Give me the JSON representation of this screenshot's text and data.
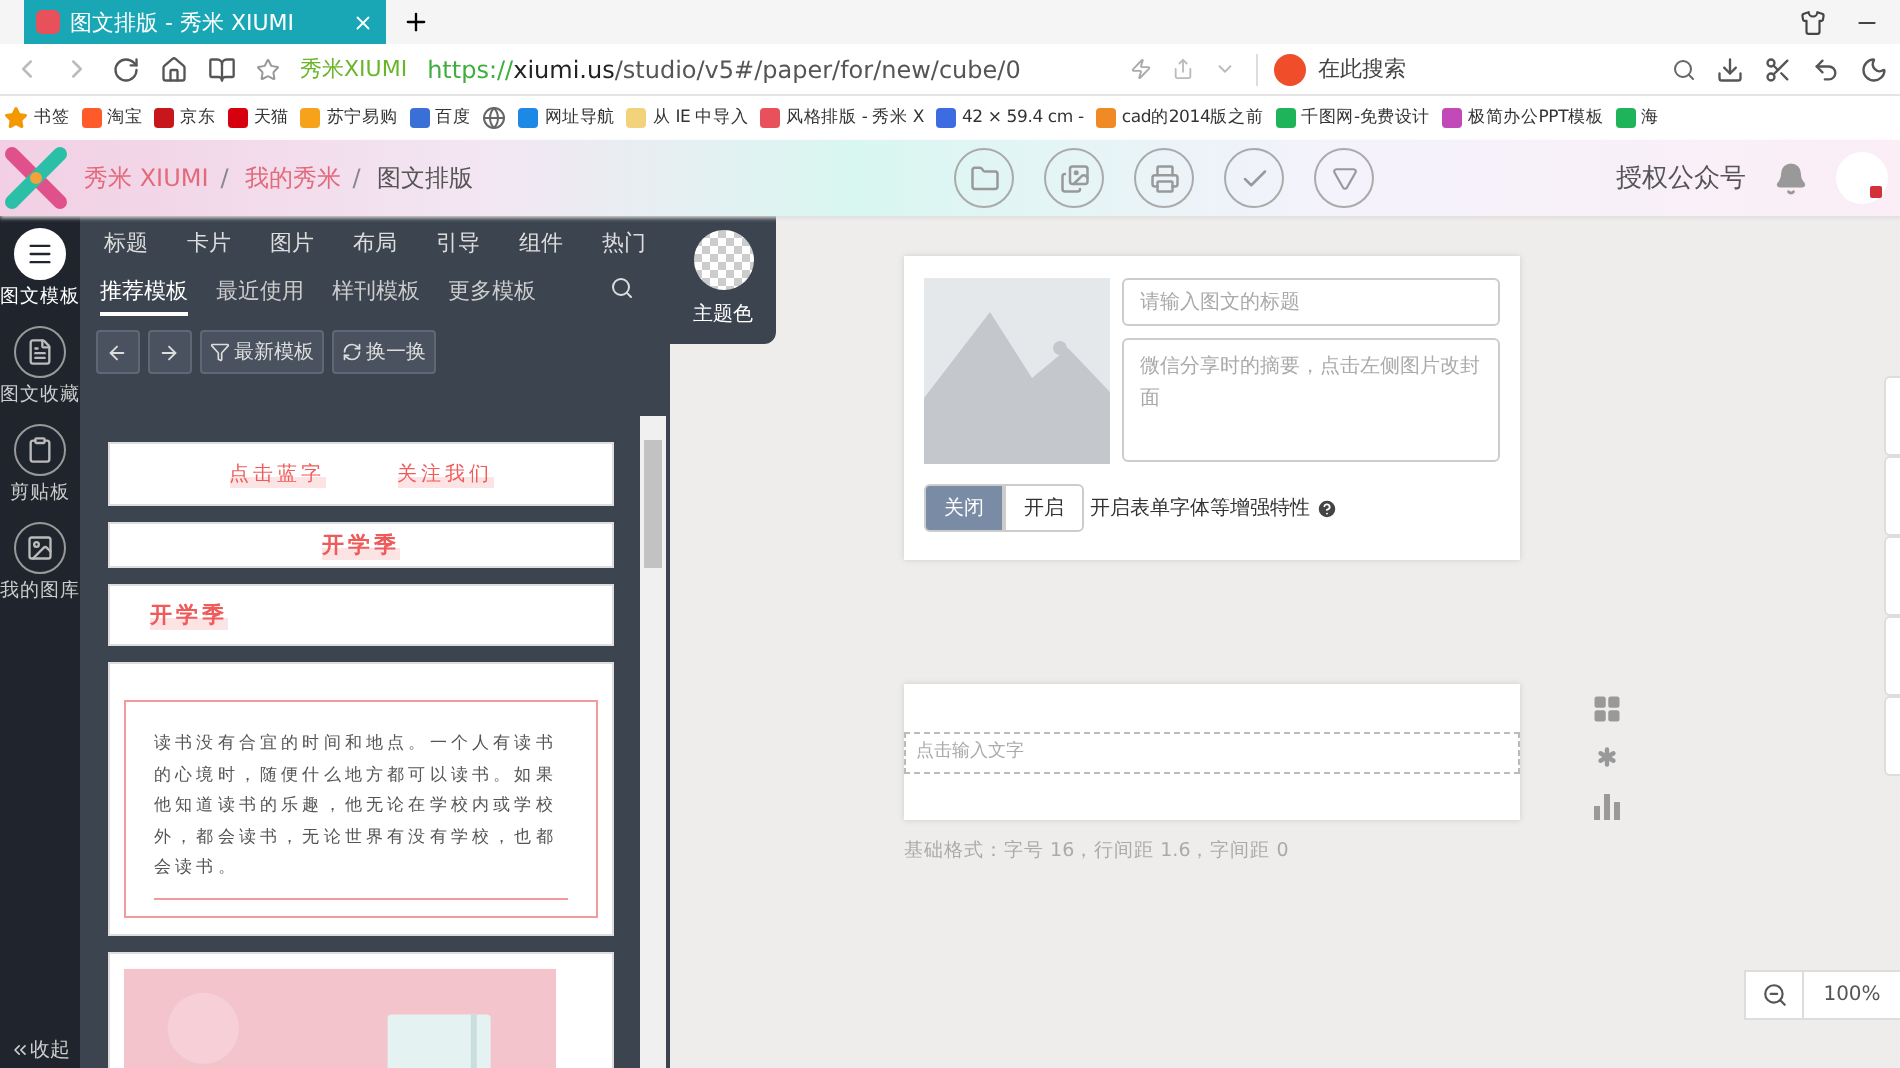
{
  "browser": {
    "tab_title": "图文排版 - 秀米 XIUMI",
    "site_name": "秀米XIUMI",
    "url_scheme": "https://",
    "url_host": "xiumi.us",
    "url_path": "/studio/v5#/paper/for/new/cube/0",
    "search_placeholder": "在此搜索",
    "bookmarks": [
      {
        "kind": "star",
        "label": "书签",
        "color": "#f39800"
      },
      {
        "kind": "site",
        "label": "淘宝",
        "color": "#ff5a2a"
      },
      {
        "kind": "site",
        "label": "京东",
        "color": "#c8161d"
      },
      {
        "kind": "site",
        "label": "天猫",
        "color": "#d6000f"
      },
      {
        "kind": "site",
        "label": "苏宁易购",
        "color": "#f7a21b"
      },
      {
        "kind": "site",
        "label": "百度",
        "color": "#3a6fd8"
      },
      {
        "kind": "globe",
        "color": "#666666"
      },
      {
        "kind": "site",
        "label": "网址导航",
        "color": "#1e88e5"
      },
      {
        "kind": "folder",
        "label": "从 IE 中导入",
        "color": "#f2d27a"
      },
      {
        "kind": "site",
        "label": "风格排版 - 秀米 X",
        "color": "#e8505b"
      },
      {
        "kind": "site",
        "label": "42 × 59.4 cm -",
        "color": "#3d6be0"
      },
      {
        "kind": "site",
        "label": "cad的2014版之前",
        "color": "#f08a24"
      },
      {
        "kind": "site",
        "label": "千图网-免费设计",
        "color": "#1fb45a"
      },
      {
        "kind": "site",
        "label": "极简办公PPT模板",
        "color": "#c24ab8"
      },
      {
        "kind": "site",
        "label": "海",
        "color": "#1fb45a"
      }
    ]
  },
  "header": {
    "breadcrumbs": [
      {
        "label": "秀米 XIUMI",
        "current": false
      },
      {
        "label": "我的秀米",
        "current": false
      },
      {
        "label": "图文排版",
        "current": true
      }
    ],
    "separator": "/",
    "authorize": "授权公众号"
  },
  "rail": {
    "items": [
      {
        "label": "图文模板",
        "selected": true
      },
      {
        "label": "图文收藏",
        "selected": false
      },
      {
        "label": "剪贴板",
        "selected": false
      },
      {
        "label": "我的图库",
        "selected": false
      }
    ],
    "collapse": "收起"
  },
  "panel": {
    "categories": [
      "标题",
      "卡片",
      "图片",
      "布局",
      "引导",
      "组件",
      "热门"
    ],
    "sub_tabs": [
      {
        "label": "推荐模板",
        "selected": true
      },
      {
        "label": "最近使用",
        "selected": false
      },
      {
        "label": "样刊模板",
        "selected": false
      },
      {
        "label": "更多模板",
        "selected": false
      }
    ],
    "newest": "最新模板",
    "shuffle": "换一换",
    "theme_label": "主题色",
    "templates": [
      {
        "kind": "follow",
        "texts": [
          "点击蓝字",
          "关注我们"
        ]
      },
      {
        "kind": "title-center",
        "texts": [
          "开学季"
        ]
      },
      {
        "kind": "title-left",
        "texts": [
          "开学季"
        ]
      },
      {
        "kind": "paragraph",
        "texts": [
          "读书没有合宜的时间和地点。一个人有读书的心境时，随便什么地方都可以读书。如果他知道读书的乐趣，他无论在学校内或学校外，都会读书，无论世界有没有学校，也都会读书。"
        ]
      },
      {
        "kind": "picture"
      }
    ]
  },
  "editor": {
    "title_placeholder": "请输入图文的标题",
    "summary_placeholder": "微信分享时的摘要，点击左侧图片改封面",
    "toggle": [
      {
        "label": "关闭",
        "selected": true
      },
      {
        "label": "开启",
        "selected": false
      }
    ],
    "toggle_label": "开启表单字体等增强特性",
    "text_placeholder": "点击输入文字",
    "format_note": "基础格式：字号 16，行间距 1.6，字间距 0",
    "zoom": "100%"
  }
}
